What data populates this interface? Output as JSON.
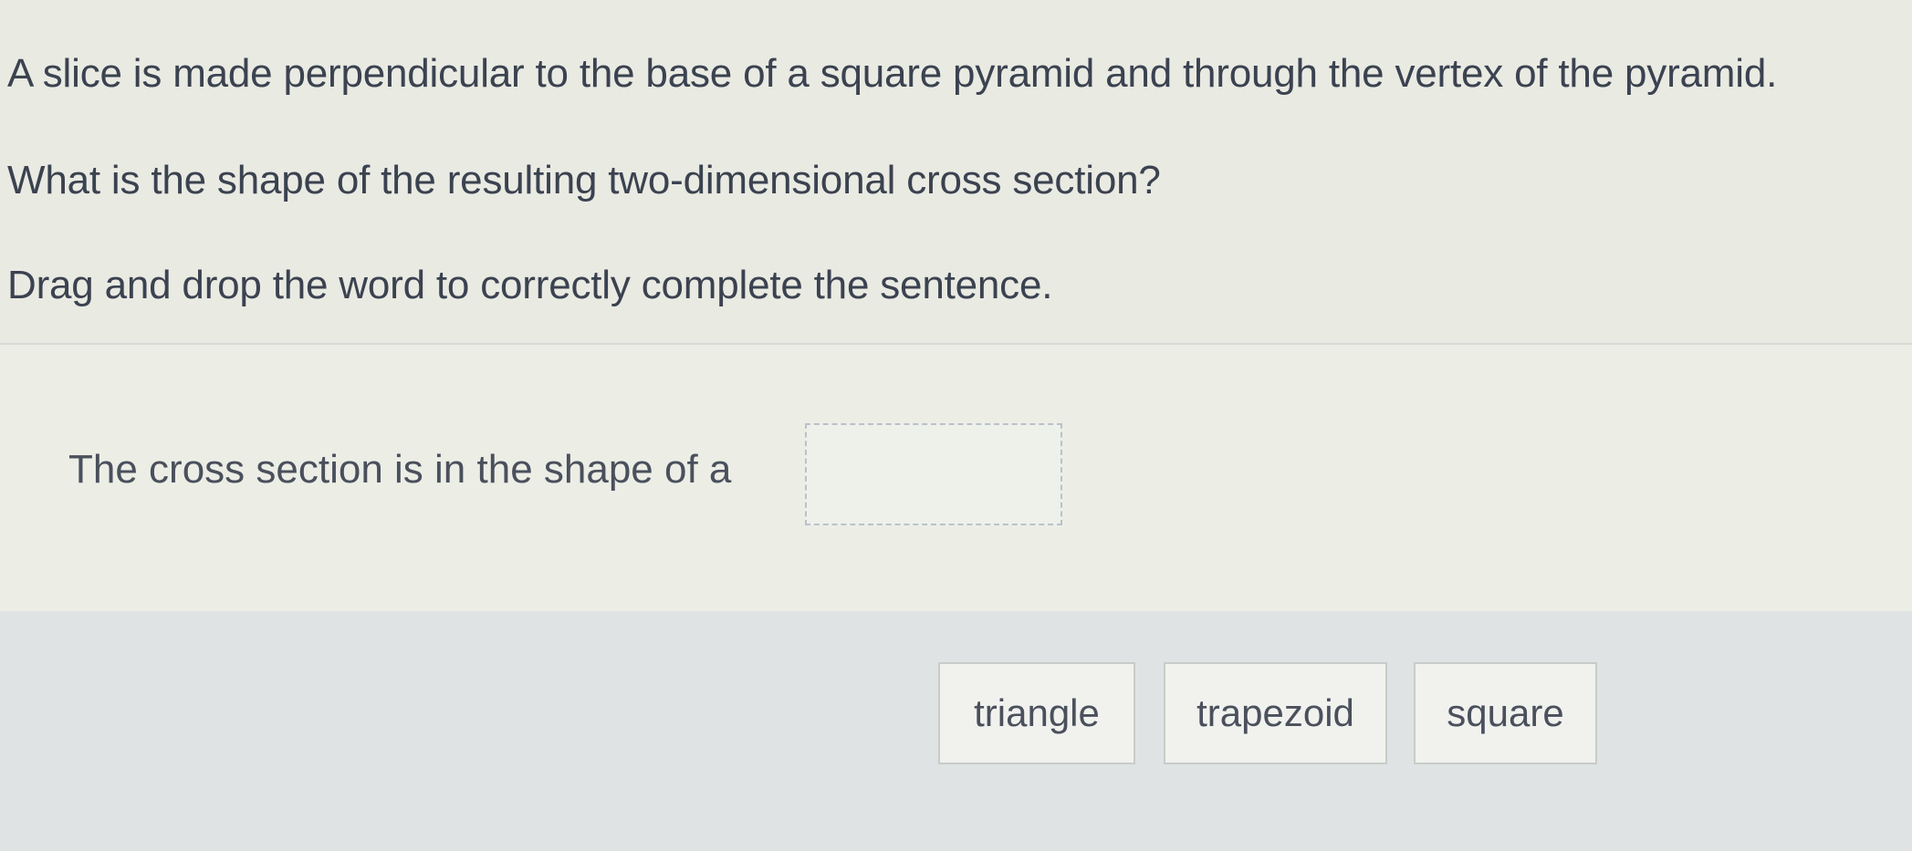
{
  "question": {
    "line1": "A slice is made perpendicular to the base of a square pyramid and through the vertex of the pyramid.",
    "line2": "What is the shape of the resulting two-dimensional cross section?",
    "instruction": "Drag and drop the word to correctly complete the sentence."
  },
  "sentence": {
    "text": "The cross section is in the shape of a",
    "blank_value": ""
  },
  "choices": [
    {
      "label": "triangle"
    },
    {
      "label": "trapezoid"
    },
    {
      "label": "square"
    }
  ]
}
